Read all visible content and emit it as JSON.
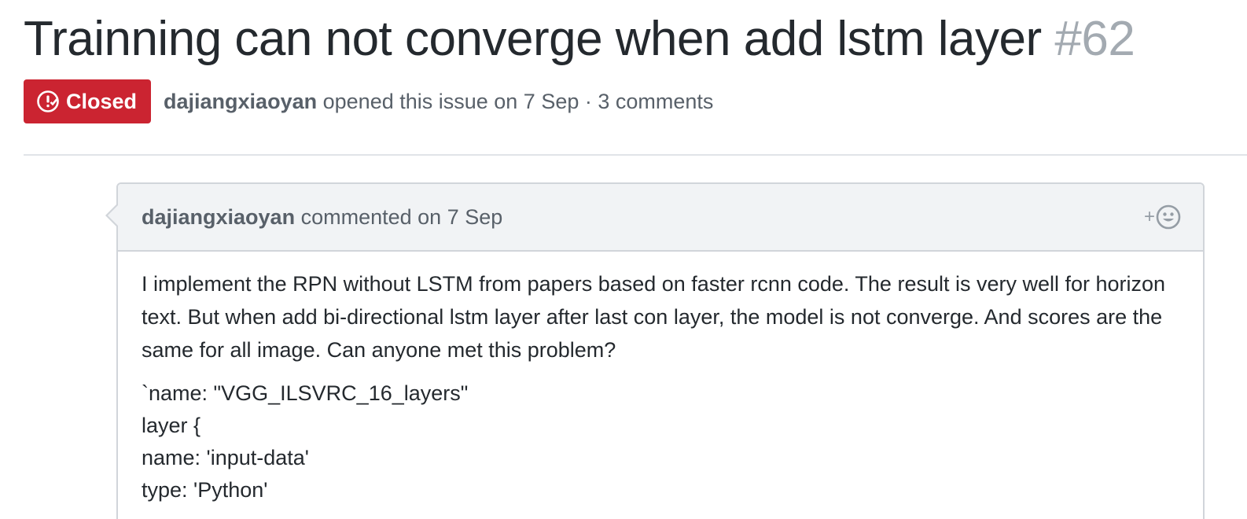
{
  "issue": {
    "title": "Trainning can not converge when add lstm layer",
    "number": "#62",
    "state": "Closed",
    "author": "dajiangxiaoyan",
    "opened_text": "opened this issue on 7 Sep · 3 comments"
  },
  "comment": {
    "author": "dajiangxiaoyan",
    "timestamp": "commented on 7 Sep",
    "reaction_plus": "+",
    "body": "I implement the RPN without LSTM from papers based on faster rcnn code. The result is very well for horizon text. But when add bi-directional lstm layer after last con layer, the model is not converge. And scores are the same for all image. Can anyone met this problem?",
    "code_lines": [
      "`name: \"VGG_ILSVRC_16_layers\"",
      "layer {",
      "name: 'input-data'",
      "type: 'Python'"
    ]
  },
  "colors": {
    "closed_badge": "#cb2431",
    "header_bg": "#f1f3f5",
    "muted_text": "#586069"
  },
  "icons": {
    "state": "issue-closed-icon",
    "reaction": "smiley-icon"
  }
}
